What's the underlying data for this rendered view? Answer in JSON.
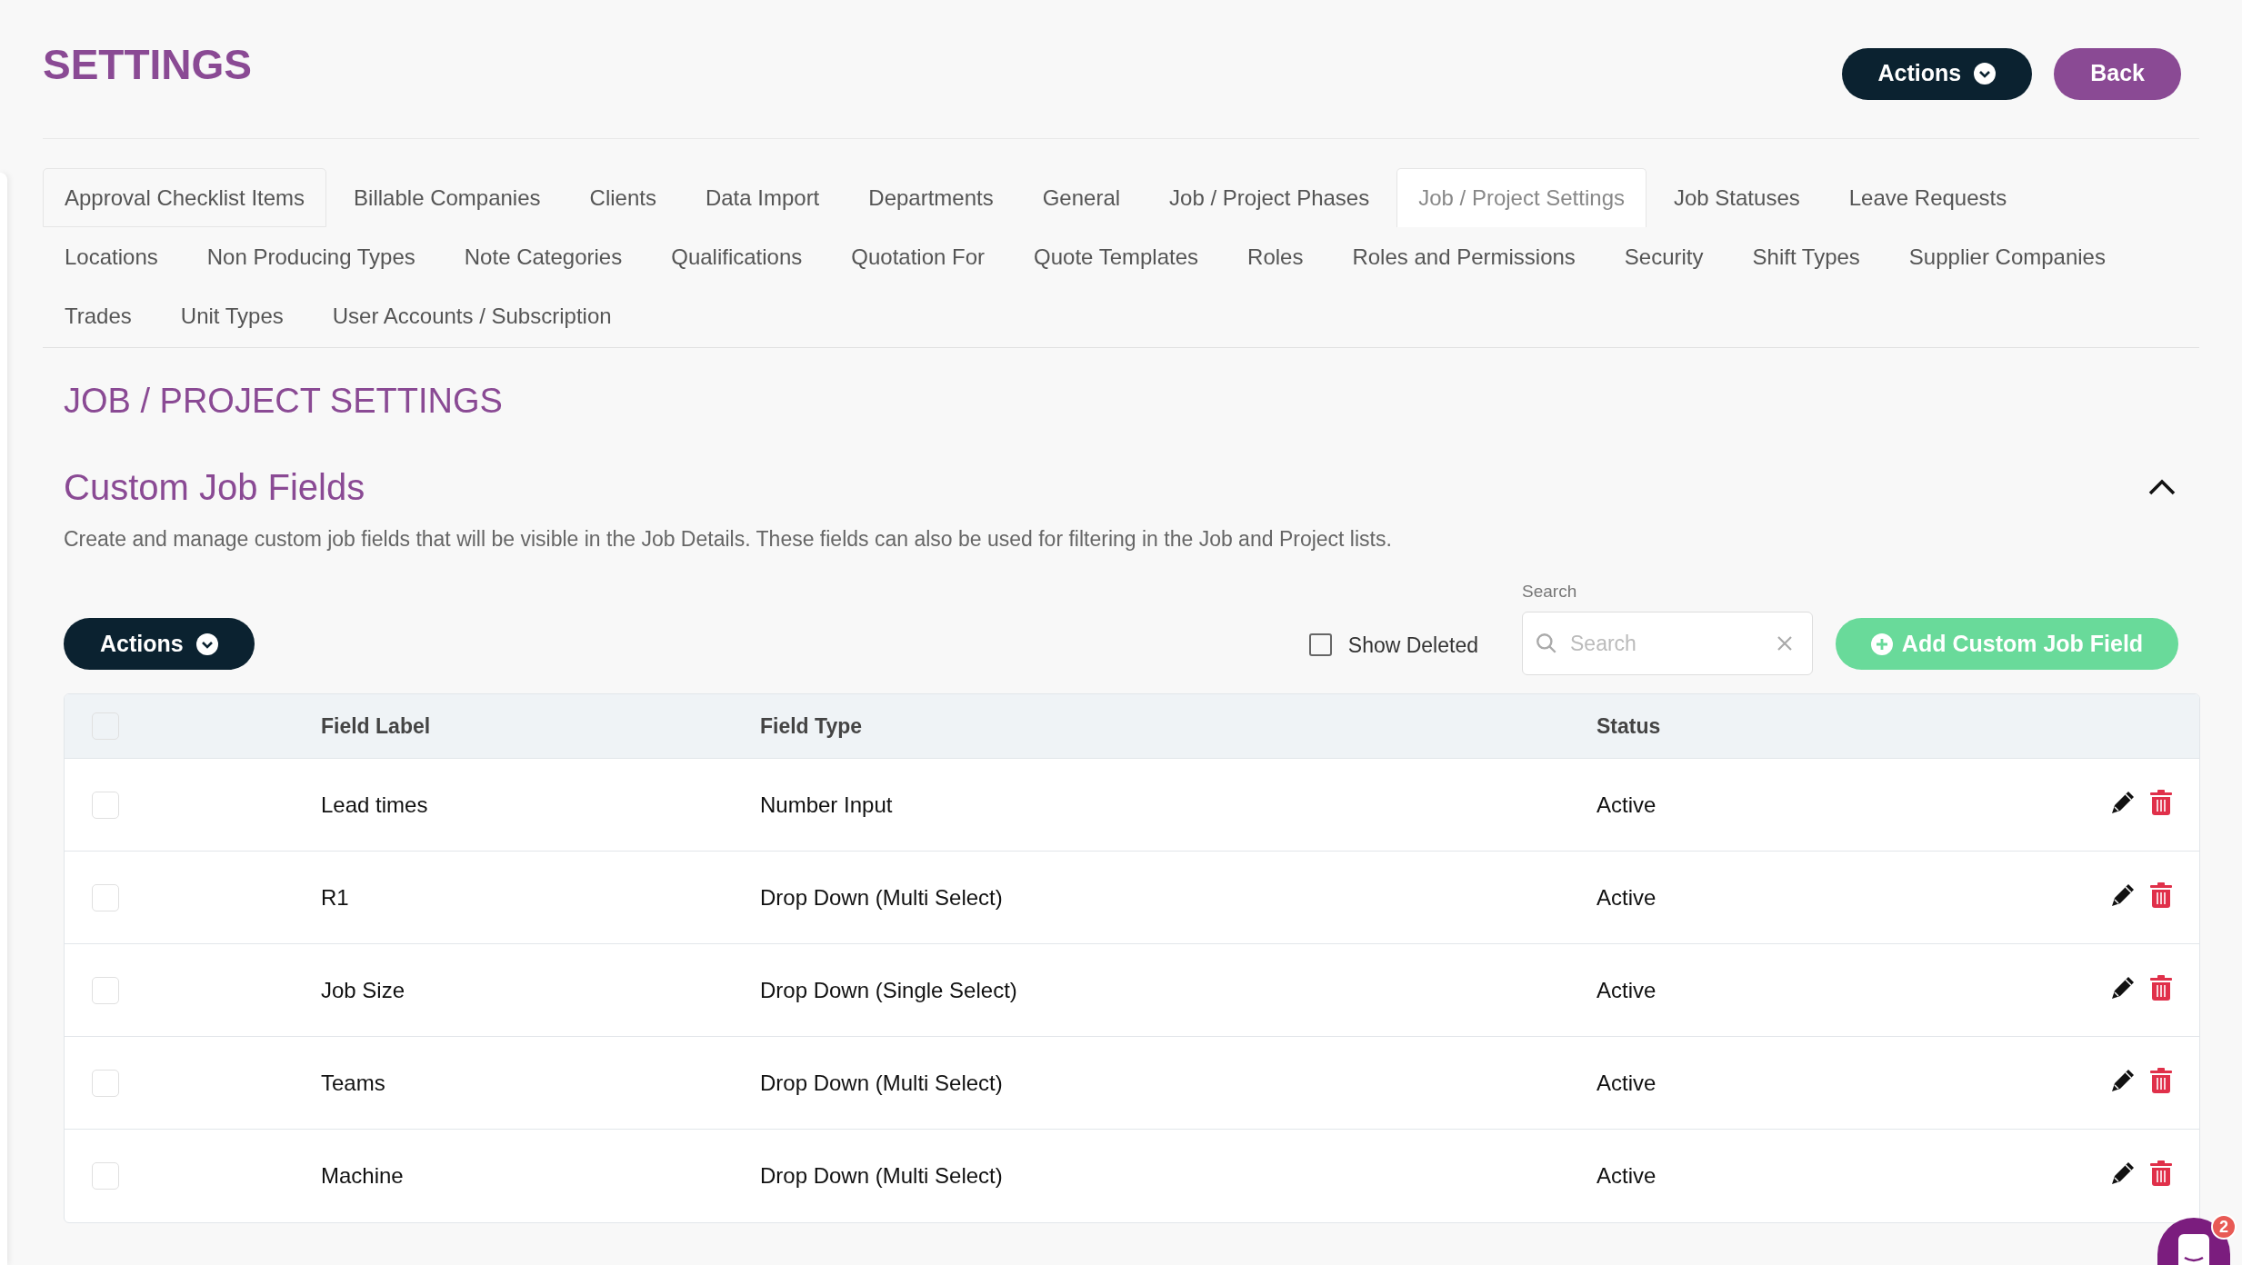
{
  "page_title": "SETTINGS",
  "header_buttons": [
    {
      "kind": "dropdown",
      "label": "Actions"
    },
    {
      "kind": "back",
      "label": "Back"
    }
  ],
  "tabs": [
    {
      "label": "Approval Checklist Items",
      "selected": false
    },
    {
      "label": "Billable Companies",
      "selected": false
    },
    {
      "label": "Clients",
      "selected": false
    },
    {
      "label": "Data Import",
      "selected": false
    },
    {
      "label": "Departments",
      "selected": false
    },
    {
      "label": "General",
      "selected": false
    },
    {
      "label": "Job / Project Phases",
      "selected": false
    },
    {
      "label": "Job / Project Settings",
      "selected": true
    },
    {
      "label": "Job Statuses",
      "selected": false
    },
    {
      "label": "Leave Requests",
      "selected": false
    },
    {
      "label": "Locations",
      "selected": false
    },
    {
      "label": "Non Producing Types",
      "selected": false
    },
    {
      "label": "Note Categories",
      "selected": false
    },
    {
      "label": "Qualifications",
      "selected": false
    },
    {
      "label": "Quotation For",
      "selected": false
    },
    {
      "label": "Quote Templates",
      "selected": false
    },
    {
      "label": "Roles",
      "selected": false
    },
    {
      "label": "Roles and Permissions",
      "selected": false
    },
    {
      "label": "Security",
      "selected": false
    },
    {
      "label": "Shift Types",
      "selected": false
    },
    {
      "label": "Supplier Companies",
      "selected": false
    },
    {
      "label": "Trades",
      "selected": false
    },
    {
      "label": "Unit Types",
      "selected": false
    },
    {
      "label": "User Accounts / Subscription",
      "selected": false
    }
  ],
  "section_title": "JOB / PROJECT SETTINGS",
  "panel": {
    "title": "Custom Job Fields",
    "expanded": true,
    "description": "Create and manage custom job fields that will be visible in the Job Details. These fields can also be used for filtering in the Job and Project lists."
  },
  "toolbar": {
    "actions_label": "Actions",
    "show_deleted": {
      "label": "Show Deleted",
      "checked": false
    },
    "search": {
      "label": "Search",
      "placeholder": "Search"
    },
    "add_button": "Add Custom Job Field"
  },
  "table": {
    "columns": [
      "Field Label",
      "Field Type",
      "Status"
    ],
    "header_checked": false,
    "rows": [
      {
        "checked": false,
        "label": "Lead times",
        "type": "Number Input",
        "status": "Active"
      },
      {
        "checked": false,
        "label": "R1",
        "type": "Drop Down (Multi Select)",
        "status": "Active"
      },
      {
        "checked": false,
        "label": "Job Size",
        "type": "Drop Down (Single Select)",
        "status": "Active"
      },
      {
        "checked": false,
        "label": "Teams",
        "type": "Drop Down (Multi Select)",
        "status": "Active"
      },
      {
        "checked": false,
        "label": "Machine",
        "type": "Drop Down (Multi Select)",
        "status": "Active"
      }
    ]
  },
  "chat": {
    "badge": "2"
  }
}
